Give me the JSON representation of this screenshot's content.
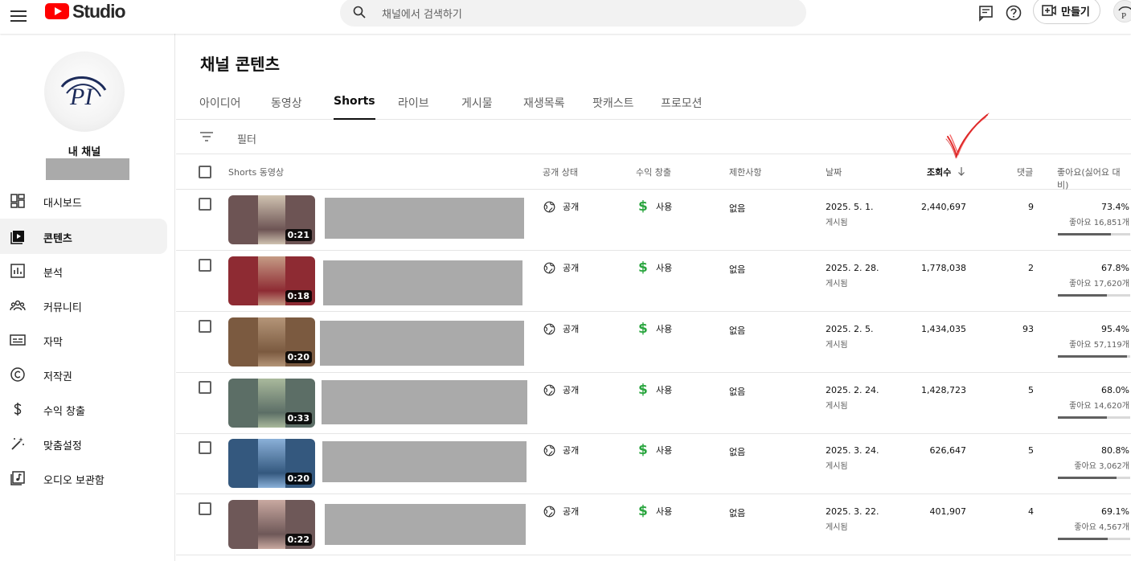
{
  "header": {
    "logo_text": "Studio",
    "search_placeholder": "채널에서 검색하기",
    "create_label": "만들기"
  },
  "sidebar": {
    "channel_label": "내 채널",
    "items": [
      {
        "label": "대시보드",
        "icon": "dashboard-icon",
        "active": false
      },
      {
        "label": "콘텐츠",
        "icon": "content-icon",
        "active": true
      },
      {
        "label": "분석",
        "icon": "analytics-icon",
        "active": false
      },
      {
        "label": "커뮤니티",
        "icon": "community-icon",
        "active": false
      },
      {
        "label": "자막",
        "icon": "subtitles-icon",
        "active": false
      },
      {
        "label": "저작권",
        "icon": "copyright-icon",
        "active": false
      },
      {
        "label": "수익 창출",
        "icon": "dollar-icon",
        "active": false
      },
      {
        "label": "맞춤설정",
        "icon": "magic-wand-icon",
        "active": false
      },
      {
        "label": "오디오 보관함",
        "icon": "audio-library-icon",
        "active": false
      }
    ]
  },
  "main": {
    "title": "채널 콘텐츠",
    "tabs": [
      {
        "label": "아이디어",
        "active": false
      },
      {
        "label": "동영상",
        "active": false
      },
      {
        "label": "Shorts",
        "active": true
      },
      {
        "label": "라이브",
        "active": false
      },
      {
        "label": "게시물",
        "active": false
      },
      {
        "label": "재생목록",
        "active": false
      },
      {
        "label": "팟캐스트",
        "active": false
      },
      {
        "label": "프로모션",
        "active": false
      }
    ],
    "filter_label": "필터",
    "columns": {
      "video": "Shorts 동영상",
      "visibility": "공개 상태",
      "monetization": "수익 창출",
      "restrictions": "제한사항",
      "date": "날짜",
      "views": "조회수",
      "comments": "댓글",
      "likes": "좋아요(싫어요 대비)"
    },
    "rows": [
      {
        "duration": "0:21",
        "visibility": "공개",
        "monetization": "사용",
        "restrictions": "없음",
        "date": "2025. 5. 1.",
        "date_status": "게시됨",
        "views": "2,440,697",
        "comments": "9",
        "like_pct": "73.4%",
        "like_count": "좋아요 16,851개",
        "like_ratio": 0.734,
        "colors": [
          "#6d5454",
          "#cfc2b0",
          "#6d5454"
        ]
      },
      {
        "duration": "0:18",
        "visibility": "공개",
        "monetization": "사용",
        "restrictions": "없음",
        "date": "2025. 2. 28.",
        "date_status": "게시됨",
        "views": "1,778,038",
        "comments": "2",
        "like_pct": "67.8%",
        "like_count": "좋아요 17,620개",
        "like_ratio": 0.678,
        "colors": [
          "#8e2b33",
          "#c59b85",
          "#8e2b33"
        ]
      },
      {
        "duration": "0:20",
        "visibility": "공개",
        "monetization": "사용",
        "restrictions": "없음",
        "date": "2025. 2. 5.",
        "date_status": "게시됨",
        "views": "1,434,035",
        "comments": "93",
        "like_pct": "95.4%",
        "like_count": "좋아요 57,119개",
        "like_ratio": 0.954,
        "colors": [
          "#7b5a40",
          "#b49578",
          "#7b5a40"
        ]
      },
      {
        "duration": "0:33",
        "visibility": "공개",
        "monetization": "사용",
        "restrictions": "없음",
        "date": "2025. 2. 24.",
        "date_status": "게시됨",
        "views": "1,428,723",
        "comments": "5",
        "like_pct": "68.0%",
        "like_count": "좋아요 14,620개",
        "like_ratio": 0.68,
        "colors": [
          "#5c6e66",
          "#a9b99c",
          "#5c6e66"
        ]
      },
      {
        "duration": "0:20",
        "visibility": "공개",
        "monetization": "사용",
        "restrictions": "없음",
        "date": "2025. 3. 24.",
        "date_status": "게시됨",
        "views": "626,647",
        "comments": "5",
        "like_pct": "80.8%",
        "like_count": "좋아요 3,062개",
        "like_ratio": 0.808,
        "colors": [
          "#34587e",
          "#8ab0d8",
          "#34587e"
        ]
      },
      {
        "duration": "0:22",
        "visibility": "공개",
        "monetization": "사용",
        "restrictions": "없음",
        "date": "2025. 3. 22.",
        "date_status": "게시됨",
        "views": "401,907",
        "comments": "4",
        "like_pct": "69.1%",
        "like_count": "좋아요 4,567개",
        "like_ratio": 0.691,
        "colors": [
          "#6e5858",
          "#c8a8a0",
          "#6e5858"
        ]
      }
    ]
  }
}
